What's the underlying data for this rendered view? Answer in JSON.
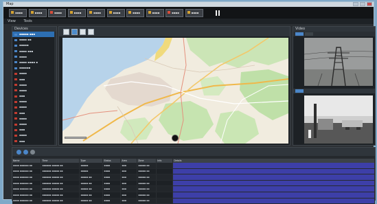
{
  "window": {
    "title": "Map",
    "controls": [
      "minimize-icon",
      "maximize-icon",
      "close-icon"
    ]
  },
  "camera_strip": {
    "cameras": [
      {
        "label": "▪▪▪▪",
        "state": "normal"
      },
      {
        "label": "▪▪▪▪",
        "state": "normal"
      },
      {
        "label": "▪▪▪▪",
        "state": "alert"
      },
      {
        "label": "▪▪▪▪",
        "state": "normal"
      },
      {
        "label": "▪▪▪▪",
        "state": "normal"
      },
      {
        "label": "▪▪▪▪",
        "state": "normal"
      },
      {
        "label": "▪▪▪▪",
        "state": "normal"
      },
      {
        "label": "▪▪▪▪",
        "state": "normal"
      },
      {
        "label": "▪▪▪▪",
        "state": "alert"
      },
      {
        "label": "▪▪▪▪",
        "state": "normal"
      }
    ],
    "status_icon": "pause-icon"
  },
  "menu": {
    "items": [
      "View",
      "Tools"
    ]
  },
  "tree_panel": {
    "header": "Devices",
    "items": [
      {
        "label": "▪▪▪▪▪ ▪▪▪",
        "selected": true,
        "kind": "normal"
      },
      {
        "label": "▪▪▪▪ ▪▪",
        "selected": false,
        "kind": "normal"
      },
      {
        "label": "▪▪▪▪▪",
        "selected": false,
        "kind": "normal"
      },
      {
        "label": "▪▪▪▪ ▪▪▪",
        "selected": false,
        "kind": "normal"
      },
      {
        "label": "▪▪▪▪",
        "selected": false,
        "kind": "normal"
      },
      {
        "label": "▪▪▪▪ ▪▪▪▪ ▪",
        "selected": false,
        "kind": "normal"
      },
      {
        "label": "▪▪▪▪▪▪",
        "selected": false,
        "kind": "normal"
      },
      {
        "label": "▪▪▪▪",
        "selected": false,
        "kind": "red"
      },
      {
        "label": "▪▪▪",
        "selected": false,
        "kind": "red"
      },
      {
        "label": "▪▪▪▪",
        "selected": false,
        "kind": "red"
      },
      {
        "label": "▪▪▪▪",
        "selected": false,
        "kind": "red"
      },
      {
        "label": "▪▪▪",
        "selected": false,
        "kind": "red"
      },
      {
        "label": "▪▪▪▪",
        "selected": false,
        "kind": "red"
      },
      {
        "label": "▪▪▪▪",
        "selected": false,
        "kind": "red"
      },
      {
        "label": "▪▪▪",
        "selected": false,
        "kind": "red"
      },
      {
        "label": "▪▪▪▪",
        "selected": false,
        "kind": "red"
      },
      {
        "label": "▪▪▪▪",
        "selected": false,
        "kind": "red"
      },
      {
        "label": "▪▪▪",
        "selected": false,
        "kind": "red"
      },
      {
        "label": "▪▪▪▪",
        "selected": false,
        "kind": "red"
      },
      {
        "label": "▪▪▪",
        "selected": false,
        "kind": "red"
      }
    ]
  },
  "map_panel": {
    "header": "Map",
    "tools": [
      {
        "icon": "hand-icon",
        "active": false
      },
      {
        "icon": "select-icon",
        "active": true
      },
      {
        "icon": "zoom-icon",
        "active": false
      },
      {
        "icon": "measure-icon",
        "active": false
      }
    ],
    "compass_icon": "compass-icon"
  },
  "video_panel": {
    "header": "Video",
    "tabs": [
      {
        "active": true
      },
      {
        "active": false
      }
    ],
    "streams": [
      "power-tower-camera",
      "thermal-camera"
    ]
  },
  "events": {
    "toolbar_icons": [
      "play-icon",
      "refresh-icon",
      "settings-icon"
    ],
    "columns": [
      "Name",
      "Time",
      "Type",
      "Status",
      "Area",
      "Zone",
      "Info",
      "Details"
    ],
    "rows": [
      [
        "▪▪▪▪ ▪▪▪▪▪▪ ▪▪",
        "▪▪▪▪▪▪ ▪▪▪▪▪ ▪▪",
        "▪▪▪▪▪",
        "▪▪▪▪",
        "▪▪▪",
        "▪▪▪▪▪ ▪▪",
        "",
        ""
      ],
      [
        "▪▪▪▪ ▪▪▪▪▪▪ ▪▪",
        "▪▪▪▪▪▪ ▪▪▪▪▪ ▪▪",
        "▪▪▪▪▪",
        "▪▪▪▪",
        "▪▪▪",
        "▪▪▪▪▪ ▪▪",
        "",
        ""
      ],
      [
        "▪▪▪▪ ▪▪▪▪▪▪ ▪▪",
        "▪▪▪▪▪▪ ▪▪▪▪▪ ▪▪",
        "▪▪▪▪▪ ▪▪",
        "▪▪▪▪",
        "▪▪▪",
        "▪▪▪▪▪ ▪▪",
        "",
        ""
      ],
      [
        "▪▪▪▪ ▪▪▪▪▪▪ ▪▪",
        "▪▪▪▪▪▪ ▪▪▪▪▪ ▪▪",
        "▪▪▪▪▪ ▪▪",
        "▪▪▪▪",
        "▪▪▪",
        "▪▪▪▪▪ ▪▪",
        "",
        ""
      ],
      [
        "▪▪▪▪ ▪▪▪▪▪▪ ▪▪",
        "▪▪▪▪▪▪ ▪▪▪▪▪ ▪▪",
        "▪▪▪▪▪ ▪▪",
        "▪▪▪▪",
        "▪▪▪",
        "▪▪▪▪▪ ▪▪",
        "",
        ""
      ],
      [
        "▪▪▪▪ ▪▪▪▪▪▪ ▪▪",
        "▪▪▪▪▪▪ ▪▪▪▪▪ ▪▪",
        "▪▪▪▪▪ ▪▪",
        "▪▪▪▪",
        "▪▪▪",
        "▪▪▪▪▪ ▪▪",
        "",
        ""
      ],
      [
        "▪▪▪▪ ▪▪▪▪▪▪ ▪▪",
        "▪▪▪▪▪▪ ▪▪▪▪▪ ▪▪",
        "▪▪▪▪▪ ▪▪",
        "▪▪▪▪",
        "▪▪▪",
        "▪▪▪▪▪ ▪▪",
        "",
        ""
      ]
    ]
  },
  "colors": {
    "accent": "#4b86c8",
    "alert": "#c23c30",
    "highlight": "#3d3fa8",
    "panel": "#1d2125"
  }
}
